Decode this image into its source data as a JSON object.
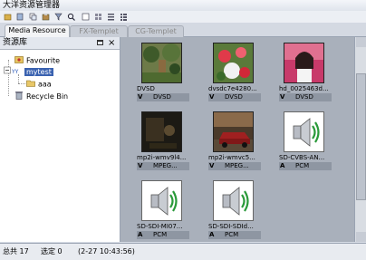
{
  "window": {
    "title": "大洋资源管理器"
  },
  "toolbar": {
    "icons": [
      "new-folder-icon",
      "open-icon",
      "copy-icon",
      "paste-icon",
      "filter-icon",
      "search-icon",
      "view-large-icon",
      "view-small-icon",
      "view-list-icon",
      "view-detail-icon"
    ]
  },
  "tabs": [
    {
      "label": "Media Resource",
      "active": true
    },
    {
      "label": "FX-Templet",
      "active": false
    },
    {
      "label": "CG-Templet",
      "active": false
    }
  ],
  "sidebar": {
    "title": "资源库",
    "tree": [
      {
        "label": "Favourite",
        "icon": "favourite-folder-icon"
      },
      {
        "label": "mytest",
        "icon": "user-library-icon",
        "selected": true
      },
      {
        "label": "aaa",
        "icon": "folder-icon"
      },
      {
        "label": "Recycle Bin",
        "icon": "recycle-bin-icon"
      }
    ]
  },
  "items": [
    {
      "name": "DVSD",
      "kind": "V",
      "format": "DVSD",
      "thumb": "garden"
    },
    {
      "name": "dvsdc7e4280...",
      "kind": "V",
      "format": "DVSD",
      "thumb": "flowers"
    },
    {
      "name": "hd_0025463d...",
      "kind": "V",
      "format": "DVSD",
      "thumb": "girl"
    },
    {
      "name": "mp2i-wmv9l4...",
      "kind": "V",
      "format": "MPEG...",
      "thumb": "dark-scene"
    },
    {
      "name": "mp2i-wmvc5...",
      "kind": "V",
      "format": "MPEG...",
      "thumb": "car"
    },
    {
      "name": "SD-CVBS-AN...",
      "kind": "A",
      "format": "PCM",
      "thumb": "audio"
    },
    {
      "name": "SD-SDI-MI07...",
      "kind": "A",
      "format": "PCM",
      "thumb": "audio"
    },
    {
      "name": "SD-SDI-SDId...",
      "kind": "A",
      "format": "PCM",
      "thumb": "audio"
    }
  ],
  "status": {
    "total": "总共 17",
    "selected": "选定 0",
    "time": "(2-27 10:43:56)"
  }
}
